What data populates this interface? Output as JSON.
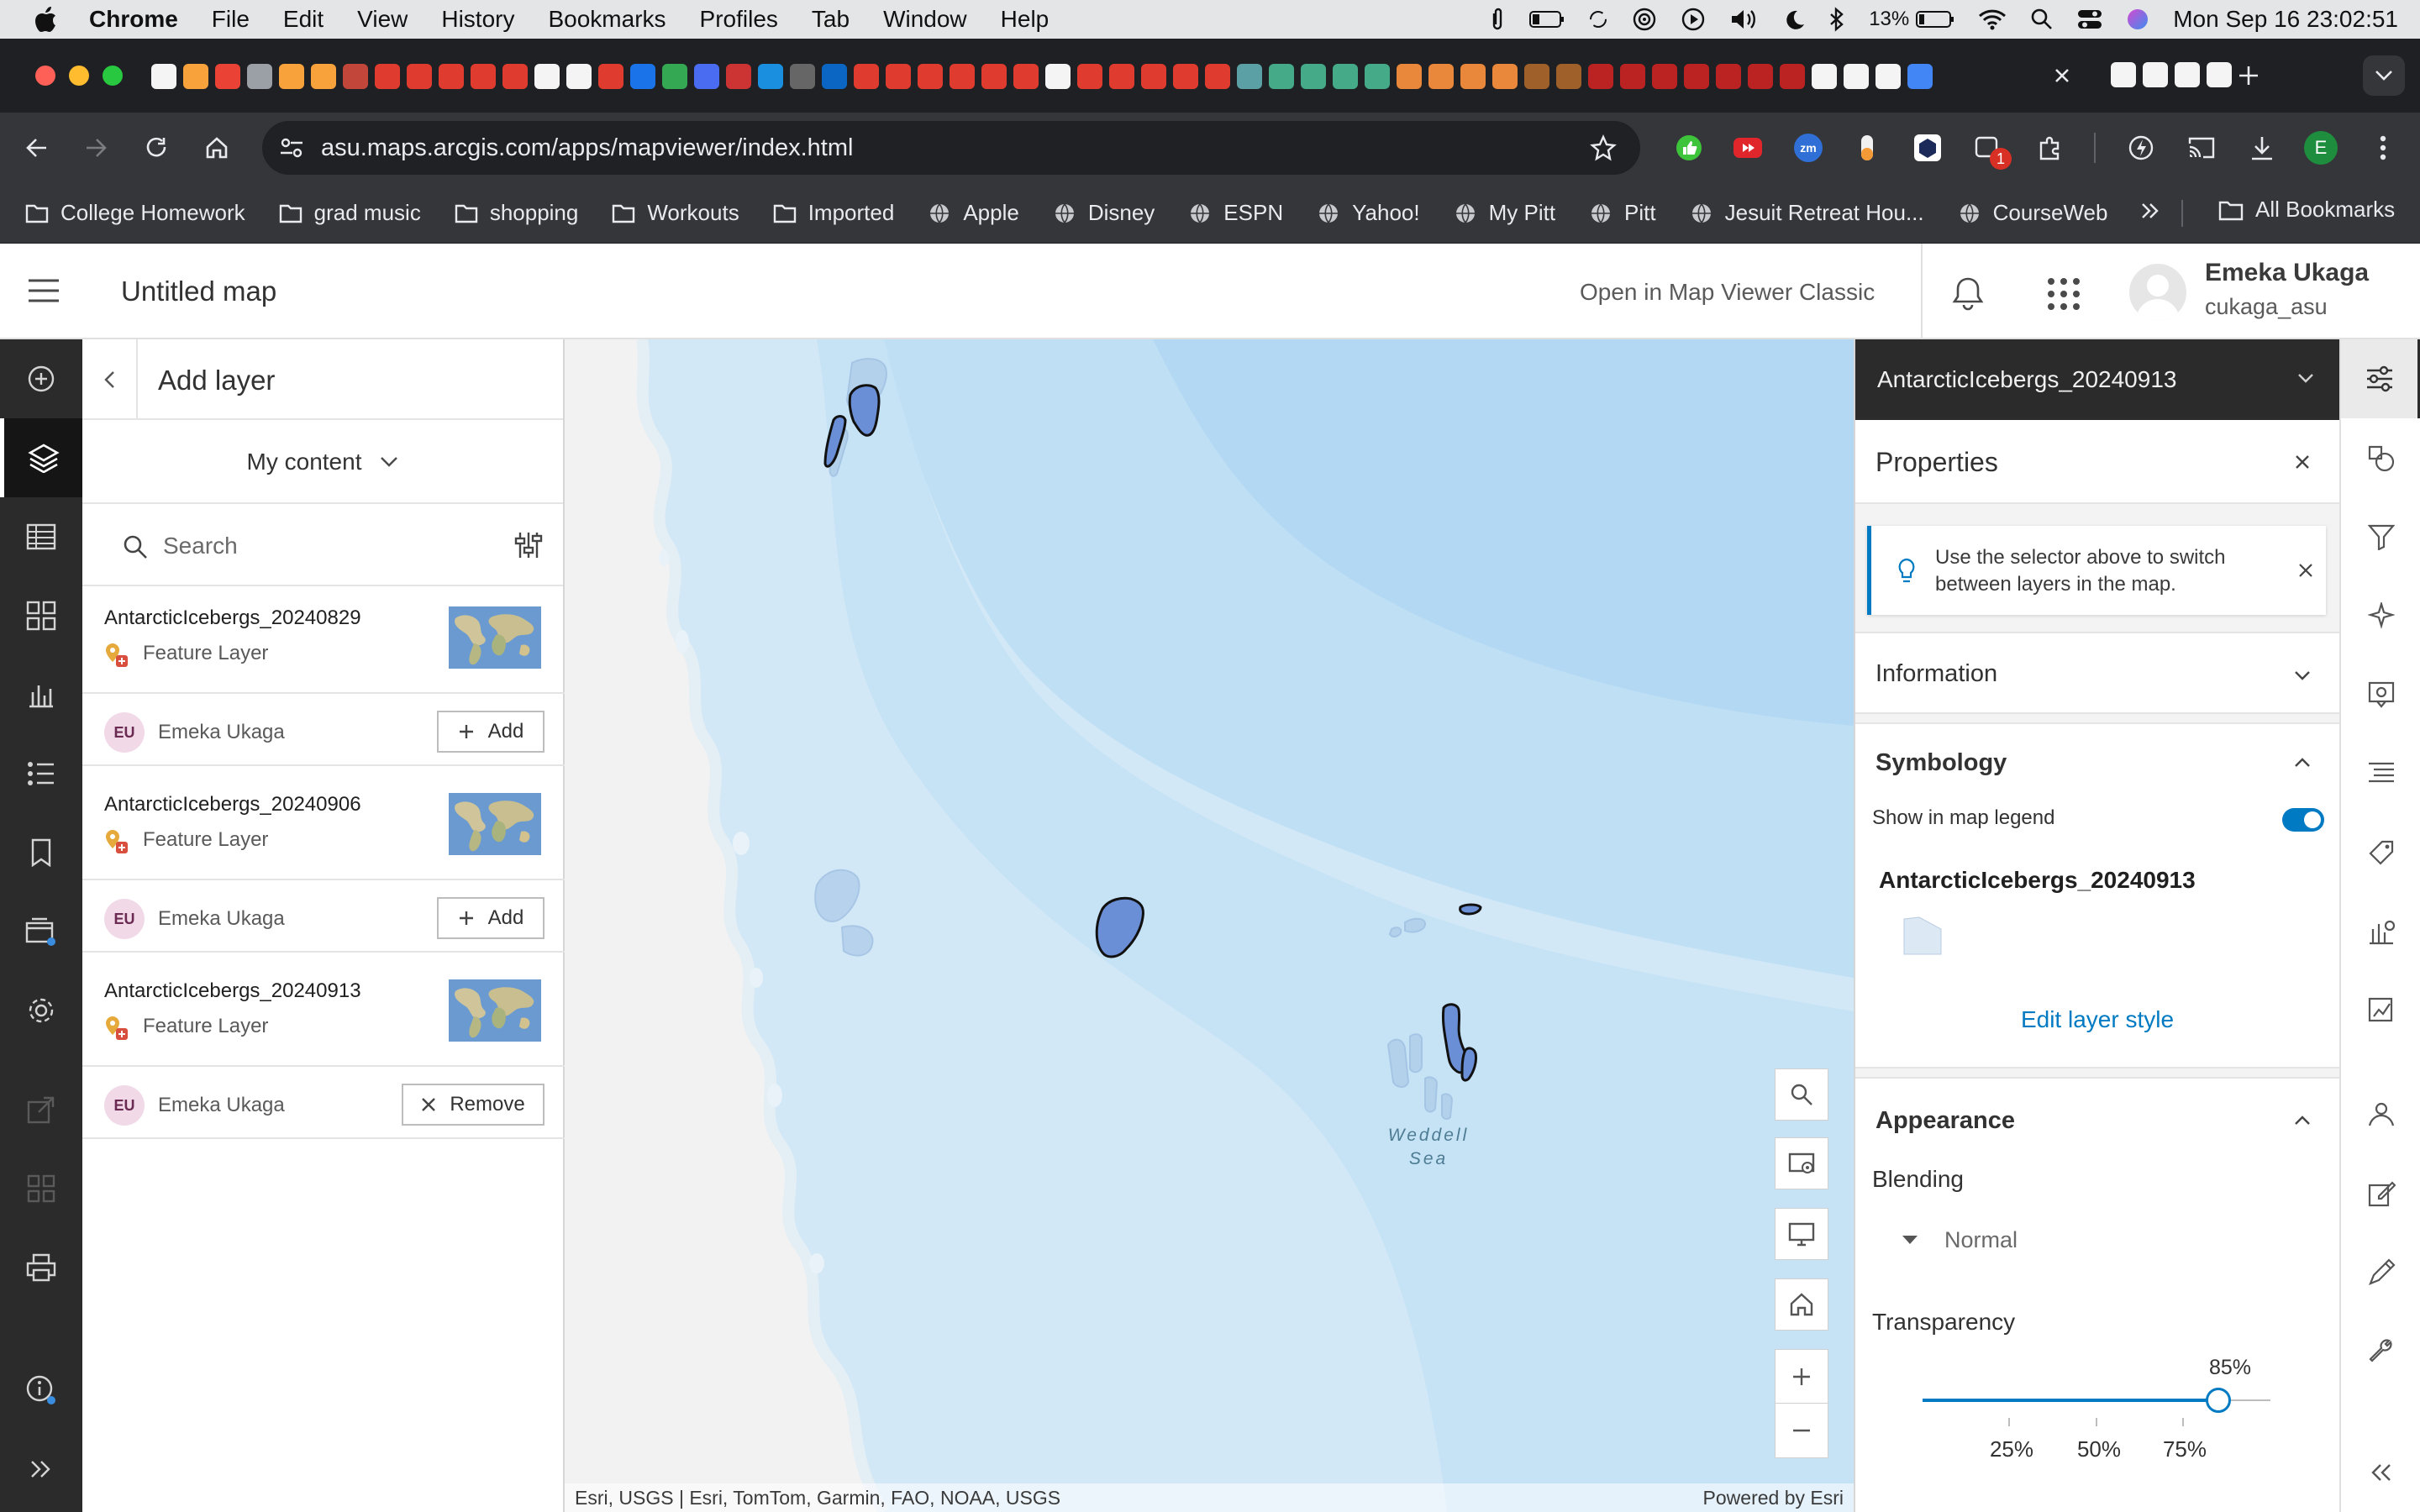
{
  "menubar": {
    "app": "Chrome",
    "menus": [
      "File",
      "Edit",
      "View",
      "History",
      "Bookmarks",
      "Profiles",
      "Tab",
      "Window",
      "Help"
    ],
    "battery": "13%",
    "datetime": "Mon Sep 16  23:02:51"
  },
  "browser": {
    "url": "asu.maps.arcgis.com/apps/mapviewer/index.html",
    "extension_badge": "1",
    "profile_initial": "E",
    "bookmarks": [
      "College Homework",
      "grad music",
      "shopping",
      "Workouts",
      "Imported",
      "Apple",
      "Disney",
      "ESPN",
      "Yahoo!",
      "My Pitt",
      "Pitt",
      "Jesuit Retreat Hou...",
      "CourseWeb"
    ],
    "all_bookmarks": "All Bookmarks"
  },
  "header": {
    "map_title": "Untitled map",
    "classic_link": "Open in Map Viewer Classic",
    "user_name": "Emeka Ukaga",
    "user_handle": "cukaga_asu"
  },
  "add_layer": {
    "title": "Add layer",
    "source": "My content",
    "search_placeholder": "Search",
    "items": [
      {
        "name": "AntarcticIcebergs_20240829",
        "type": "Feature Layer",
        "owner_initials": "EU",
        "owner": "Emeka Ukaga",
        "action": "Add"
      },
      {
        "name": "AntarcticIcebergs_20240906",
        "type": "Feature Layer",
        "owner_initials": "EU",
        "owner": "Emeka Ukaga",
        "action": "Add"
      },
      {
        "name": "AntarcticIcebergs_20240913",
        "type": "Feature Layer",
        "owner_initials": "EU",
        "owner": "Emeka Ukaga",
        "action": "Remove"
      }
    ]
  },
  "map": {
    "label_line1": "Weddell",
    "label_line2": "Sea",
    "attribution": "Esri, USGS | Esri, TomTom, Garmin, FAO, NOAA, USGS",
    "powered_by": "Powered by Esri"
  },
  "properties": {
    "layer_selector": "AntarcticIcebergs_20240913",
    "title": "Properties",
    "tip": "Use the selector above to switch between layers in the map.",
    "information": "Information",
    "symbology": "Symbology",
    "show_legend": "Show in map legend",
    "legend_layer": "AntarcticIcebergs_20240913",
    "edit_style": "Edit layer style",
    "appearance": "Appearance",
    "blending": "Blending",
    "blending_value": "Normal",
    "transparency": "Transparency",
    "transparency_value": "85%",
    "transparency_level": 0.85,
    "ticks": [
      "25%",
      "50%",
      "75%"
    ]
  },
  "colors": {
    "accent": "#007ac2",
    "toolbar_dark": "#2b2b2b",
    "iceberg_fill": "#6b8fd6",
    "water": "#cfe6f5"
  }
}
